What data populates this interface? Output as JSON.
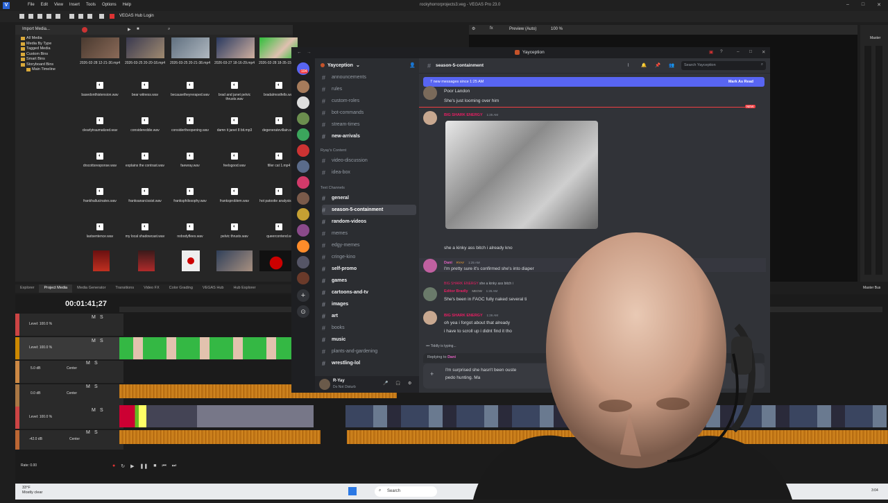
{
  "app": {
    "window_title": "rockyhorrorprojects3.veg - VEGAS Pro 23.0",
    "menu": [
      "File",
      "Edit",
      "View",
      "Insert",
      "Tools",
      "Options",
      "Help"
    ],
    "hub_login": "VEGAS Hub Login"
  },
  "media_panel": {
    "import_label": "Import Media...",
    "tree": [
      "All Media",
      "Media By Type",
      "Tagged Media",
      "Custom Bins",
      "Smart Bins",
      "Storyboard Bins",
      "Main Timeline"
    ],
    "video_files": [
      "2026-02-28 12-21-30.mp4",
      "2026-03-25 20-20-18.mp4",
      "2026-03-25 20-21-38.mp4",
      "2026-03-27 18-16-29.mp4",
      "2026-02-28 18-35-15.mp4"
    ],
    "audio_files": [
      "basedonthistension.wav",
      "bear witness.wav",
      "becausetheyreraped.wav",
      "brad and janet pelvic thrusts.wav",
      "bradalmostfells.wav",
      "clearlytraumatized.wav",
      "considereddie.wav",
      "considertheopening.wav",
      "damn it janet 8 bit.mp3",
      "degeneratevillain.wav",
      "drscottsresponse.wav",
      "explains the contrast.wav",
      "faewray.wav",
      "feelsgood.wav",
      "filler cat 1.mp4",
      "frankhallucinates.wav",
      "franksanarcissist.wav",
      "franksphilosophy.wav",
      "franksproblem.wav",
      "hot patootie analysis.wav",
      "lastsentence.wav",
      "my local shadowcast.wav",
      "nobodyflees.wav",
      "pelvic thrusts.wav",
      "queercontend.w"
    ]
  },
  "tabs": [
    "Explorer",
    "Project Media",
    "Media Generator",
    "Transitions",
    "Video FX",
    "Color Grading",
    "VEGAS Hub",
    "Hub Explorer"
  ],
  "active_tab": "Project Media",
  "preview": {
    "mode": "Preview (Auto)",
    "zoom": "100 %",
    "master_label": "Master",
    "master_bus": "Master Bus"
  },
  "timeline": {
    "timecode": "00:01:41;27",
    "tracks": [
      {
        "level": "Level: 100.0 %"
      },
      {
        "level": "Level: 100.0 %"
      },
      {
        "vol": "5.0 dB",
        "pan": "Center"
      },
      {
        "vol": "0.0 dB",
        "pan": "Center"
      },
      {
        "level": "Level: 100.0 %"
      },
      {
        "vol": "-42.0 dB",
        "pan": "Center"
      }
    ],
    "rate": "Rate: 0.00"
  },
  "discord": {
    "window_title": "Yayception",
    "server_name": "Yayception",
    "guild_badge": "104",
    "channel_name": "season-5-containment",
    "search_placeholder": "Search Yayception",
    "categories": [
      "Ryay's Content",
      "Text Channels"
    ],
    "channels_top": [
      {
        "name": "announcements",
        "unread": false
      },
      {
        "name": "rules",
        "unread": false
      },
      {
        "name": "custom-roles",
        "unread": false
      },
      {
        "name": "bot-commands",
        "unread": false
      },
      {
        "name": "stream-times",
        "unread": false
      },
      {
        "name": "new-arrivals",
        "unread": true
      }
    ],
    "channels_ryay": [
      {
        "name": "video-discussion",
        "unread": false
      },
      {
        "name": "idea-box",
        "unread": false
      }
    ],
    "channels_text": [
      {
        "name": "general",
        "unread": true
      },
      {
        "name": "season-5-containment",
        "unread": true,
        "active": true
      },
      {
        "name": "random-videos",
        "unread": true
      },
      {
        "name": "memes",
        "unread": false
      },
      {
        "name": "edgy-memes",
        "unread": false
      },
      {
        "name": "cringe-kino",
        "unread": false
      },
      {
        "name": "self-promo",
        "unread": true
      },
      {
        "name": "games",
        "unread": true
      },
      {
        "name": "cartoons-and-tv",
        "unread": true
      },
      {
        "name": "images",
        "unread": true
      },
      {
        "name": "art",
        "unread": true
      },
      {
        "name": "books",
        "unread": false
      },
      {
        "name": "music",
        "unread": true
      },
      {
        "name": "plants-and-gardening",
        "unread": false
      },
      {
        "name": "wrestling-lol",
        "unread": true
      }
    ],
    "user": {
      "name": "R-Yay",
      "status": "Do Not Disturb"
    },
    "new_messages_banner": "7 new messages since 1:25 AM",
    "mark_as_read": "Mark As Read",
    "new_badge": "NEW",
    "messages": [
      {
        "text1": "Poor Landon",
        "text2": "She's just looming over him"
      },
      {
        "user": "BIG SHARK ENERGY",
        "time": "1:25 AM",
        "text": "she a kinky ass bitch i already kno"
      },
      {
        "user": "Dani",
        "time": "1:25 AM",
        "role": "RYAY",
        "text": "I'm pretty sure it's confirmed she's into diaper"
      },
      {
        "reply_user": "BIG SHARK ENERGY",
        "reply_text": "she a kinky ass bitch i",
        "user": "Editor Bradly",
        "role": "MEOW",
        "time": "1:26 AM",
        "text": "She's been in FAGC fully naked several ti"
      },
      {
        "user": "BIG SHARK ENERGY",
        "time": "1:26 AM",
        "text1": "oh yea i forgot about that already",
        "text2": "i have to scroll up i didnt find it tho"
      }
    ],
    "typing": "Tiddly is typing...",
    "replying_to": "Replying to",
    "reply_target": "Dani",
    "draft_line1": "I'm surprised she hasn't been ouste",
    "draft_line1_tail": "rom th",
    "draft_line2": "pedo hunting. Ma"
  },
  "taskbar": {
    "temp": "33°F",
    "weather": "Mostly clear",
    "search": "Search",
    "clock": "3:04"
  }
}
